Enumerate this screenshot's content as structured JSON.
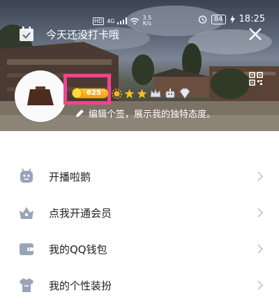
{
  "status_bar": {
    "hd": "HD",
    "network": "4G",
    "speed_value": "3.5",
    "speed_unit": "K/s",
    "battery": "84",
    "time": "18:25"
  },
  "header": {
    "checkin_text": "今天还没打卡哦",
    "coins": "625",
    "signature": "编辑个签，展示我的独特态度。"
  },
  "menu": [
    {
      "label": "开播啦鹅",
      "icon": "penguin-icon"
    },
    {
      "label": "点我开通会员",
      "icon": "crown-icon"
    },
    {
      "label": "我的QQ钱包",
      "icon": "wallet-icon"
    },
    {
      "label": "我的个性装扮",
      "icon": "shirt-icon"
    }
  ],
  "colors": {
    "highlight": "#f0448d",
    "coin": "#f5a200",
    "icon_gray": "#9aa3b8"
  }
}
